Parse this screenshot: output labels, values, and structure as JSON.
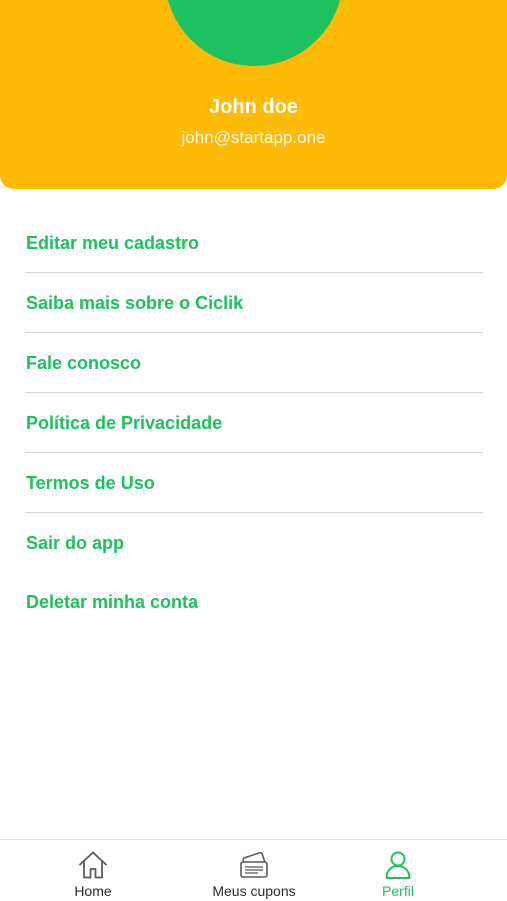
{
  "colors": {
    "header_bg": "#FDBA07",
    "accent_green": "#1DC25E",
    "divider": "#D7D7D7",
    "tab_inactive": "#2B2B2B"
  },
  "profile": {
    "name": "John doe",
    "email": "john@startapp.one"
  },
  "menu": {
    "items": [
      {
        "label": "Editar meu cadastro"
      },
      {
        "label": "Saiba mais sobre o Ciclik"
      },
      {
        "label": "Fale conosco"
      },
      {
        "label": "Política de Privacidade"
      },
      {
        "label": "Termos de Uso"
      },
      {
        "label": "Sair do app"
      },
      {
        "label": "Deletar minha conta"
      }
    ]
  },
  "tabbar": {
    "tabs": [
      {
        "label": "Home",
        "icon": "home-icon",
        "active": false
      },
      {
        "label": "Meus cupons",
        "icon": "coupons-icon",
        "active": false
      },
      {
        "label": "Perfil",
        "icon": "profile-icon",
        "active": true
      }
    ]
  }
}
